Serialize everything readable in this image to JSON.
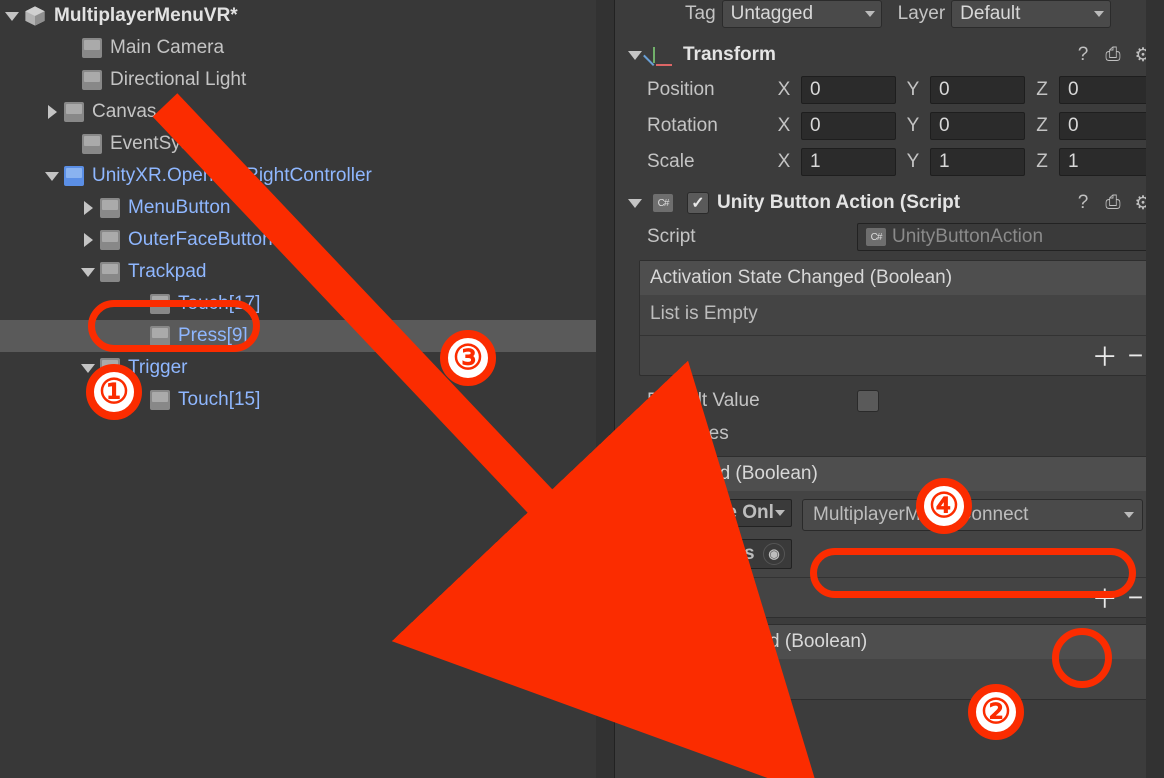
{
  "hierarchy": {
    "scene": "MultiplayerMenuVR*",
    "items": [
      {
        "name": "Main Camera"
      },
      {
        "name": "Directional Light"
      },
      {
        "name": "Canvas"
      },
      {
        "name": "EventSystem"
      }
    ],
    "controller": {
      "name": "UnityXR.OpenVR.RightController",
      "children": [
        {
          "name": "MenuButton"
        },
        {
          "name": "OuterFaceButton"
        },
        {
          "name": "Trackpad",
          "children": [
            {
              "name": "Touch[17]"
            },
            {
              "name": "Press[9]"
            }
          ]
        },
        {
          "name": "Trigger",
          "children": [
            {
              "name": "Touch[15]"
            }
          ]
        }
      ]
    }
  },
  "inspector": {
    "tag_label": "Tag",
    "tag_value": "Untagged",
    "layer_label": "Layer",
    "layer_value": "Default",
    "transform": {
      "title": "Transform",
      "position_label": "Position",
      "rotation_label": "Rotation",
      "scale_label": "Scale",
      "axes": {
        "x": "X",
        "y": "Y",
        "z": "Z"
      },
      "position": {
        "x": "0",
        "y": "0",
        "z": "0"
      },
      "rotation": {
        "x": "0",
        "y": "0",
        "z": "0"
      },
      "scale": {
        "x": "1",
        "y": "1",
        "z": "1"
      }
    },
    "component": {
      "title": "Unity Button Action (Script",
      "script_label": "Script",
      "script_value": "UnityButtonAction",
      "events": {
        "activation_state_changed": {
          "title": "Activation State Changed (Boolean)",
          "body": "List is Empty"
        },
        "default_value_label": "Default Value",
        "sources_label": "Sources",
        "activated": {
          "title": "Activated (Boolean)",
          "runtime": "Runtime Onl",
          "function": "MultiplayerMenu.Connect",
          "object": "Canvas"
        },
        "value_changed": {
          "title": "Value Changed (Boolean)",
          "body": "List is Empty"
        }
      }
    }
  },
  "annotations": {
    "n1": "①",
    "n2": "②",
    "n3": "③",
    "n4": "④"
  }
}
